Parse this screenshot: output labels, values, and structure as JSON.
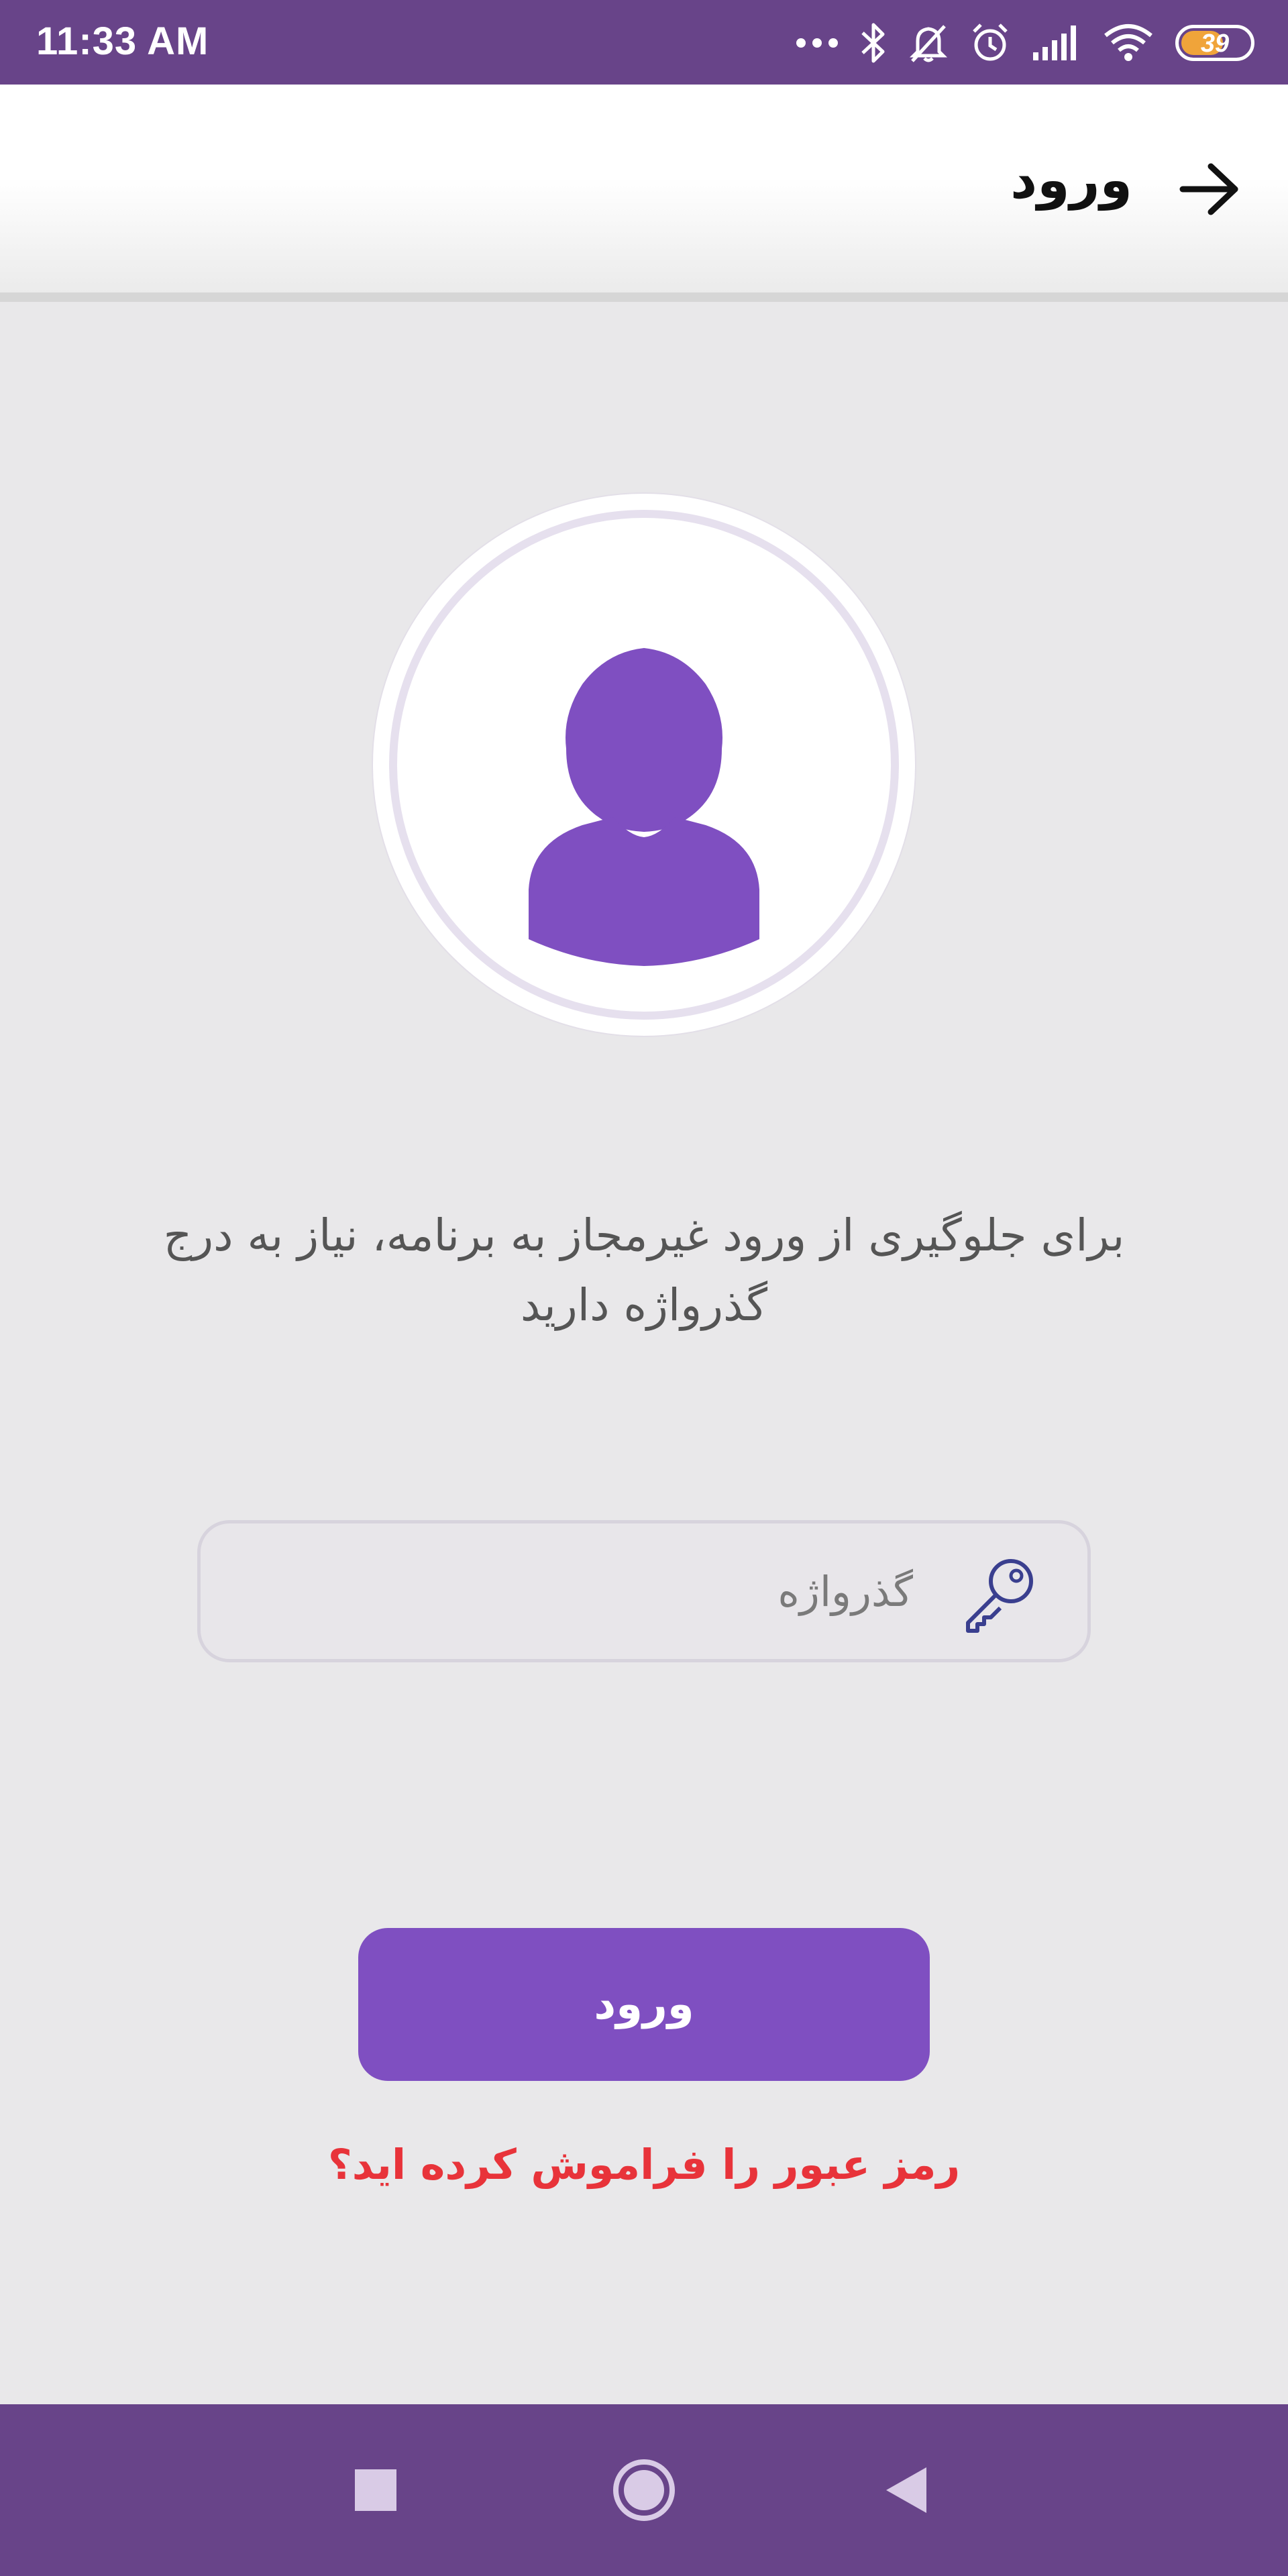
{
  "status_bar": {
    "time": "11:33 AM",
    "battery_level": "39",
    "icons": [
      "more-dots-icon",
      "bluetooth-icon",
      "notifications-off-icon",
      "alarm-icon",
      "signal-icon",
      "wifi-icon",
      "battery-icon"
    ],
    "background_color": "#684489"
  },
  "toolbar": {
    "title": "ورود",
    "back_icon": "arrow-right-icon"
  },
  "avatar": {
    "icon": "user-icon",
    "color": "#7f4fc1"
  },
  "message": {
    "line1": "برای جلوگیری از ورود غیرمجاز به برنامه، نیاز به درج",
    "line2": "گذرواژه دارید"
  },
  "password": {
    "placeholder": "گذرواژه",
    "value": "",
    "icon": "key-icon"
  },
  "login_button": {
    "label": "ورود",
    "color": "#7f4fc1"
  },
  "forgot_link": {
    "label": "رمز عبور را فراموش کرده اید؟",
    "color": "#e8333a"
  },
  "nav_bar": {
    "recent_icon": "recent-apps-icon",
    "home_icon": "home-icon",
    "back_icon": "back-icon"
  }
}
